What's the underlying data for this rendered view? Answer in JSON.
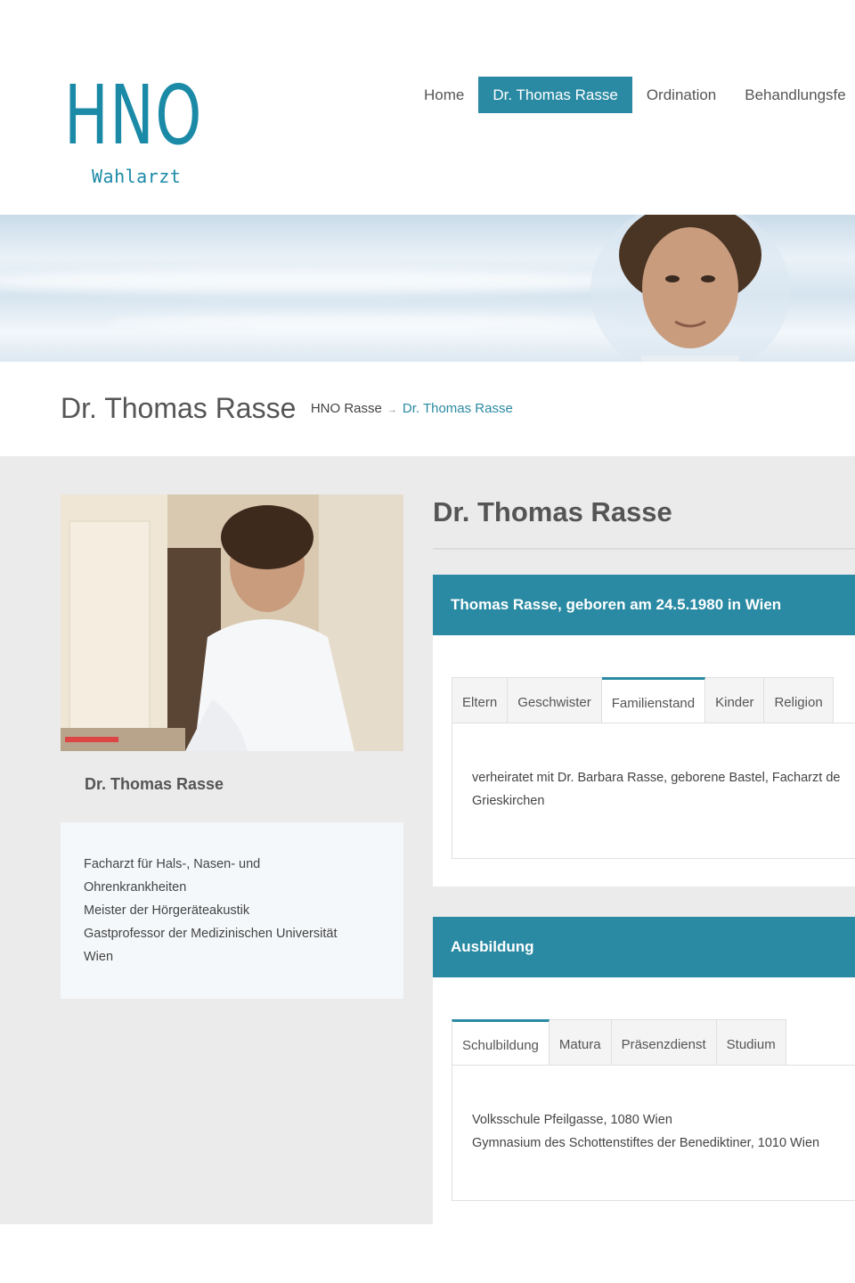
{
  "logo": {
    "main": "HNO",
    "sub": "Wahlarzt"
  },
  "nav": [
    {
      "label": "Home"
    },
    {
      "label": "Dr. Thomas Rasse"
    },
    {
      "label": "Ordination"
    },
    {
      "label": "Behandlungsfe"
    }
  ],
  "page_title": "Dr. Thomas Rasse",
  "breadcrumb": {
    "home": "HNO Rasse",
    "separator": "→",
    "current": "Dr. Thomas Rasse"
  },
  "sidebar": {
    "name": "Dr. Thomas Rasse",
    "lines": [
      "Facharzt für Hals-, Nasen- und",
      "Ohrenkrankheiten",
      "Meister der Hörgeräteakustik",
      "Gastprofessor der Medizinischen Universität",
      "Wien"
    ]
  },
  "main": {
    "title": "Dr. Thomas Rasse",
    "panel1": {
      "heading": "Thomas Rasse, geboren am 24.5.1980 in Wien",
      "tabs": [
        "Eltern",
        "Geschwister",
        "Familienstand",
        "Kinder",
        "Religion"
      ],
      "active_tab": "Familienstand",
      "content": [
        "verheiratet mit Dr. Barbara Rasse, geborene Bastel, Facharzt de",
        "Grieskirchen"
      ]
    },
    "panel2": {
      "heading": "Ausbildung",
      "tabs": [
        "Schulbildung",
        "Matura",
        "Präsenzdienst",
        "Studium"
      ],
      "active_tab": "Schulbildung",
      "content": [
        "Volksschule Pfeilgasse, 1080 Wien",
        "Gymnasium des Schottenstiftes der Benediktiner, 1010 Wien"
      ]
    }
  },
  "colors": {
    "accent": "#2a8aa3",
    "logo": "#1b8aa6",
    "content_bg": "#ebebeb"
  }
}
